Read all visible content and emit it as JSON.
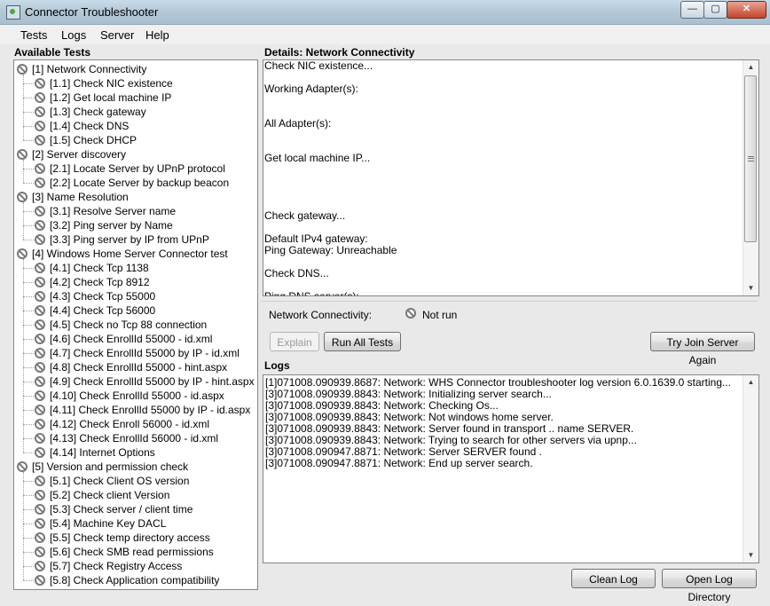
{
  "window": {
    "title": "Connector Troubleshooter",
    "min_glyph": "—",
    "max_glyph": "▢",
    "close_glyph": "✕"
  },
  "menu": [
    "Tests",
    "Logs",
    "Server",
    "Help"
  ],
  "available_tests": {
    "label": "Available Tests",
    "items": [
      {
        "text": "[1] Network Connectivity",
        "level": 0
      },
      {
        "text": "[1.1] Check NIC existence",
        "level": 1
      },
      {
        "text": "[1.2] Get local machine IP",
        "level": 1
      },
      {
        "text": "[1.3] Check gateway",
        "level": 1
      },
      {
        "text": "[1.4] Check DNS",
        "level": 1
      },
      {
        "text": "[1.5] Check DHCP",
        "level": 1
      },
      {
        "text": "[2] Server discovery",
        "level": 0
      },
      {
        "text": "[2.1] Locate Server by UPnP protocol",
        "level": 1
      },
      {
        "text": "[2.2] Locate Server by backup beacon",
        "level": 1
      },
      {
        "text": "[3] Name Resolution",
        "level": 0
      },
      {
        "text": "[3.1] Resolve Server name",
        "level": 1
      },
      {
        "text": "[3.2] Ping server by Name",
        "level": 1
      },
      {
        "text": "[3.3] Ping server by IP from UPnP",
        "level": 1
      },
      {
        "text": "[4] Windows Home Server Connector test",
        "level": 0
      },
      {
        "text": "[4.1] Check Tcp 1138",
        "level": 1
      },
      {
        "text": "[4.2] Check Tcp 8912",
        "level": 1
      },
      {
        "text": "[4.3] Check Tcp 55000",
        "level": 1
      },
      {
        "text": "[4.4] Check Tcp 56000",
        "level": 1
      },
      {
        "text": "[4.5] Check no Tcp 88 connection",
        "level": 1
      },
      {
        "text": "[4.6] Check EnrollId 55000 - id.xml",
        "level": 1
      },
      {
        "text": "[4.7] Check EnrollId 55000 by IP - id.xml",
        "level": 1
      },
      {
        "text": "[4.8] Check EnrollId 55000 - hint.aspx",
        "level": 1
      },
      {
        "text": "[4.9] Check EnrollId 55000 by IP - hint.aspx",
        "level": 1
      },
      {
        "text": "[4.10] Check EnrollId 55000 - id.aspx",
        "level": 1
      },
      {
        "text": "[4.11] Check EnrollId 55000 by IP - id.aspx",
        "level": 1
      },
      {
        "text": "[4.12] Check Enroll 56000 - id.xml",
        "level": 1
      },
      {
        "text": "[4.13] Check EnrollId 56000 - id.xml",
        "level": 1
      },
      {
        "text": "[4.14] Internet Options",
        "level": 1
      },
      {
        "text": "[5] Version and permission check",
        "level": 0
      },
      {
        "text": "[5.1] Check Client OS version",
        "level": 1
      },
      {
        "text": "[5.2] Check client Version",
        "level": 1
      },
      {
        "text": "[5.3] Check server / client time",
        "level": 1
      },
      {
        "text": "[5.4] Machine Key DACL",
        "level": 1
      },
      {
        "text": "[5.5] Check temp directory access",
        "level": 1
      },
      {
        "text": "[5.6] Check SMB read permissions",
        "level": 1
      },
      {
        "text": "[5.7] Check Registry Access",
        "level": 1
      },
      {
        "text": "[5.8] Check Application compatibility",
        "level": 1
      }
    ]
  },
  "details": {
    "label": "Details: Network Connectivity",
    "text": "Check NIC existence...\n\nWorking Adapter(s):\n\n\nAll Adapter(s):\n\n\nGet local machine IP...\n\n\n\n\nCheck gateway...\n\nDefault IPv4 gateway:\nPing Gateway: Unreachable\n\nCheck DNS...\n\nPing DNS server(s):"
  },
  "status": {
    "label": "Network Connectivity:",
    "value": "Not run"
  },
  "buttons": {
    "explain": "Explain",
    "run_all": "Run All Tests",
    "try_join": "Try Join Server Again",
    "clean_log": "Clean Log",
    "open_log_dir": "Open Log Directory"
  },
  "logs": {
    "label": "Logs",
    "lines": [
      "[1]071008.090939.8687: Network: WHS Connector troubleshooter log version 6.0.1639.0 starting...",
      "[3]071008.090939.8843: Network: Initializing server search...",
      "[3]071008.090939.8843: Network: Checking Os...",
      "[3]071008.090939.8843: Network: Not windows home server.",
      "[3]071008.090939.8843: Network: Server found in transport .. name SERVER.",
      "[3]071008.090939.8843: Network: Trying to search for other servers via upnp...",
      "[3]071008.090947.8871: Network: Server SERVER found .",
      "[3]071008.090947.8871: Network: End up server search."
    ]
  },
  "scroll_arrows": {
    "up": "▲",
    "down": "▼"
  }
}
